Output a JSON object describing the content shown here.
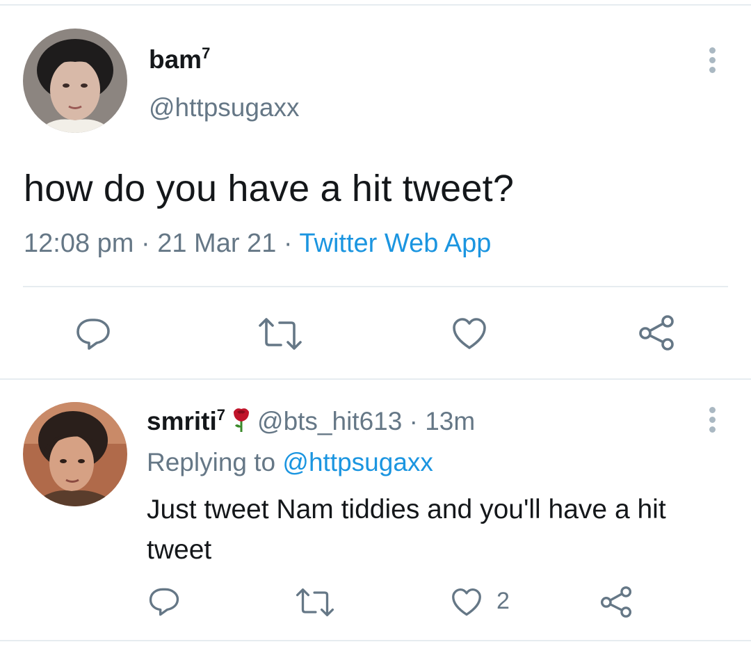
{
  "tweet": {
    "author_name": "bam",
    "author_sup": "7",
    "author_handle": "@httpsugaxx",
    "text": "how do you have a hit tweet?",
    "time": "12:08 pm",
    "sep1": " · ",
    "date": "21 Mar 21",
    "sep2": " · ",
    "source": "Twitter Web App",
    "actions": [
      "reply-icon",
      "retweet-icon",
      "like-icon",
      "share-icon"
    ],
    "more_icon": "more-vertical-icon"
  },
  "reply": {
    "author_name": "smriti",
    "author_sup": "7",
    "emoji_icon": "rose-icon",
    "author_handle": "@bts_hit613",
    "time_sep": " · ",
    "time": "13m",
    "replying_prefix": "Replying to ",
    "replying_to": "@httpsugaxx",
    "text": "Just tweet Nam tiddies and you'll have a hit tweet",
    "like_count": "2",
    "more_icon": "more-vertical-icon"
  },
  "colors": {
    "text": "#14171a",
    "secondary": "#657786",
    "link": "#1b95e0",
    "border": "#e6ecf0"
  }
}
